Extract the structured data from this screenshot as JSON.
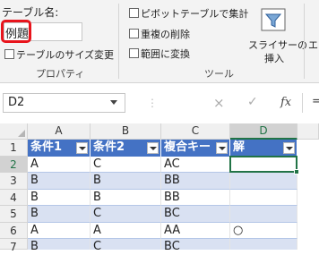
{
  "ribbon": {
    "table_name_label": "テーブル名:",
    "table_name_value": "例題",
    "resize_label": "テーブルのサイズ変更",
    "group_properties": "プロパティ",
    "pivot_label": "ピボットテーブルで集計",
    "remove_dup_label": "重複の削除",
    "convert_label": "範囲に変換",
    "group_tools": "ツール",
    "slicer_label_1": "スライサーの",
    "slicer_label_2": "挿入",
    "export_partial": "エ"
  },
  "formula_bar": {
    "name_box": "D2",
    "cancel": "×",
    "enter": "✓",
    "fx": "fx",
    "eq": "="
  },
  "sheet": {
    "columns": [
      "A",
      "B",
      "C",
      "D"
    ],
    "headers": [
      "条件1",
      "条件2",
      "複合キー",
      "解"
    ],
    "rows": [
      {
        "num": "1"
      },
      {
        "num": "2",
        "cells": [
          "A",
          "C",
          "AC",
          ""
        ]
      },
      {
        "num": "3",
        "cells": [
          "B",
          "B",
          "BB",
          ""
        ]
      },
      {
        "num": "4",
        "cells": [
          "B",
          "B",
          "BB",
          ""
        ]
      },
      {
        "num": "5",
        "cells": [
          "B",
          "C",
          "BC",
          ""
        ]
      },
      {
        "num": "6",
        "cells": [
          "A",
          "A",
          "AA",
          "○"
        ]
      },
      {
        "num": "7",
        "cells": [
          "B",
          "C",
          "BC",
          ""
        ]
      }
    ]
  },
  "colors": {
    "header_fill": "#4472c4",
    "band_fill": "#d9e1f2",
    "highlight": "#e8141c",
    "selection": "#217346"
  }
}
